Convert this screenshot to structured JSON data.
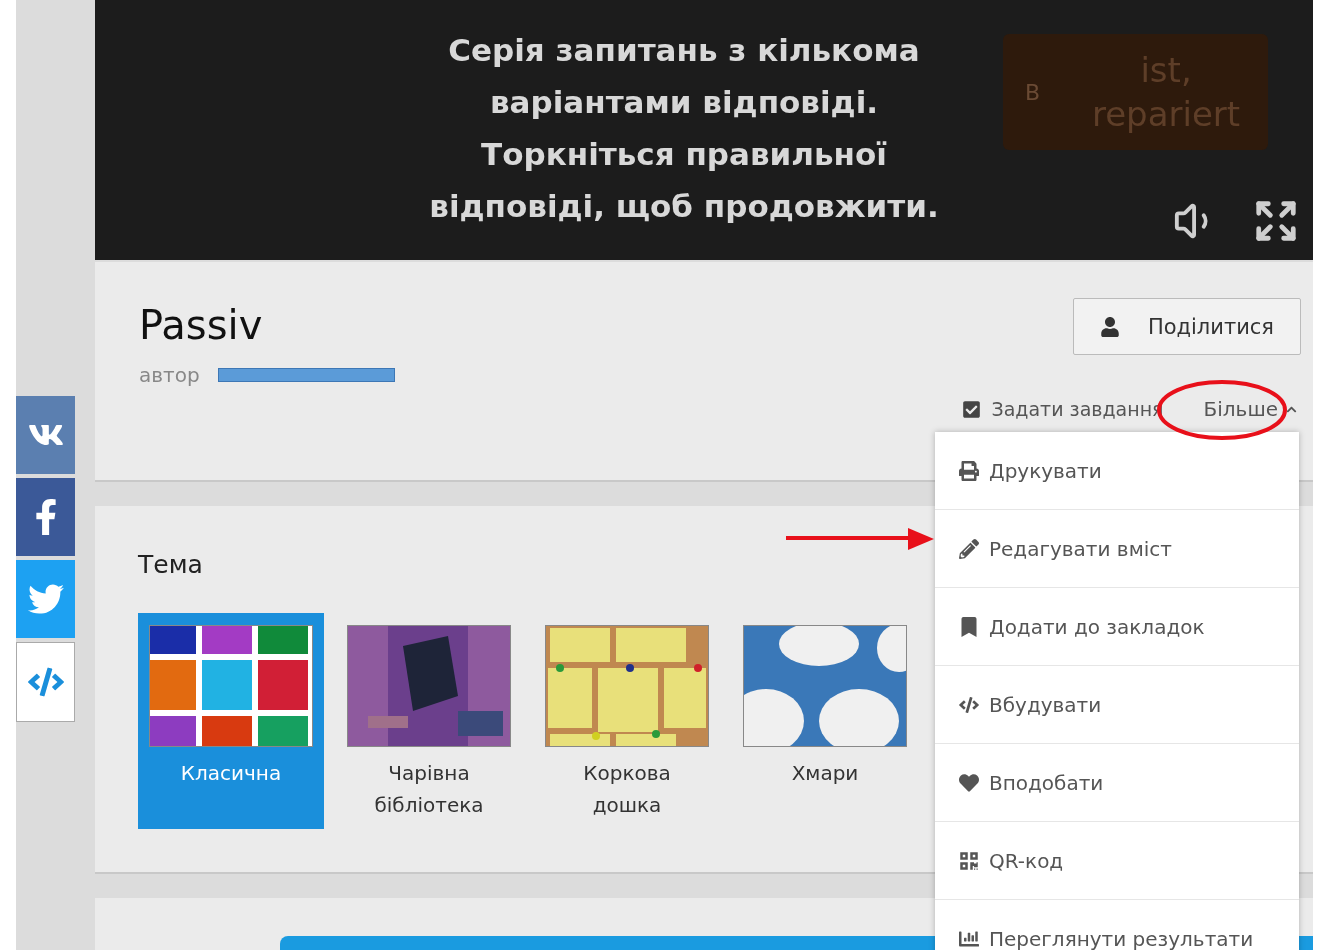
{
  "game_frame": {
    "prompt": "Серія запитань з кількома варіантами відповіді. Торкніться правильної відповіді, щоб продовжити.",
    "answer_card": {
      "letter": "B",
      "text": "ist, repariert"
    }
  },
  "social": [
    {
      "kind": "vk"
    },
    {
      "kind": "facebook"
    },
    {
      "kind": "twitter"
    },
    {
      "kind": "embed"
    }
  ],
  "activity": {
    "title": "Passiv",
    "author_label": "автор",
    "share_button": "Поділитися",
    "assign": {
      "label": "Задати завдання",
      "checked": true
    },
    "more": {
      "label": "Більше",
      "expanded": true
    }
  },
  "more_menu": [
    {
      "label": "Друкувати",
      "kind": "print"
    },
    {
      "label": "Редагувати вміст",
      "kind": "edit"
    },
    {
      "label": "Додати до закладок",
      "kind": "bookmark"
    },
    {
      "label": "Вбудувати",
      "kind": "embed"
    },
    {
      "label": "Вподобати",
      "kind": "like"
    },
    {
      "label": "QR-код",
      "kind": "qr"
    },
    {
      "label": "Переглянути результати",
      "kind": "results"
    }
  ],
  "theme": {
    "heading": "Тема",
    "options": [
      {
        "label": "Класична",
        "selected": true,
        "kind": "classic"
      },
      {
        "label": "Чарівна бібліотека",
        "selected": false,
        "kind": "library"
      },
      {
        "label": "Коркова дошка",
        "selected": false,
        "kind": "corkboard"
      },
      {
        "label": "Хмари",
        "selected": false,
        "kind": "clouds"
      }
    ]
  }
}
